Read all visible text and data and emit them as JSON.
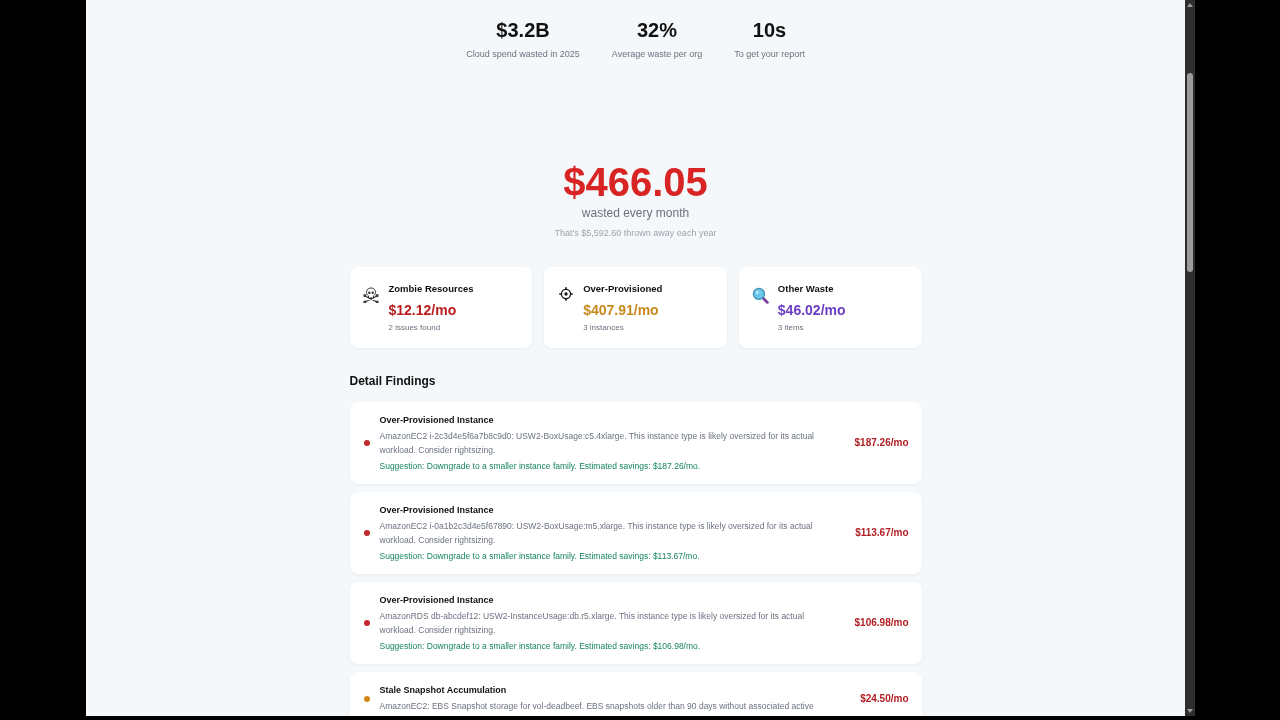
{
  "stats": [
    {
      "value": "$3.2B",
      "label": "Cloud spend wasted in 2025"
    },
    {
      "value": "32%",
      "label": "Average waste per org"
    },
    {
      "value": "10s",
      "label": "To get your report"
    }
  ],
  "total": {
    "amount": "$466.05",
    "caption": "wasted every month",
    "yearly": "That's $5,592.60 thrown away each year"
  },
  "summary_cards": [
    {
      "kind": "zombie",
      "title": "Zombie Resources",
      "amount": "$12.12/mo",
      "detail": "2 issues found",
      "color": "#b91c1c"
    },
    {
      "kind": "overprovisioned",
      "title": "Over-Provisioned",
      "amount": "$407.91/mo",
      "detail": "3 instances",
      "color": "#c98a1d"
    },
    {
      "kind": "other",
      "title": "Other Waste",
      "amount": "$46.02/mo",
      "detail": "3 items",
      "color": "#6b3cc4"
    }
  ],
  "findings": {
    "title": "Detail Findings",
    "items": [
      {
        "title": "Over-Provisioned Instance",
        "description": "AmazonEC2 i-2c3d4e5f6a7b8c9d0: USW2-BoxUsage:c5.4xlarge. This instance type is likely oversized for its actual workload. Consider rightsizing.",
        "suggestion": "Suggestion: Downgrade to a smaller instance family. Estimated savings: $187.26/mo.",
        "amount": "$187.26/mo",
        "color": "#c0282d"
      },
      {
        "title": "Over-Provisioned Instance",
        "description": "AmazonEC2 i-0a1b2c3d4e5f67890: USW2-BoxUsage:m5.xlarge. This instance type is likely oversized for its actual workload. Consider rightsizing.",
        "suggestion": "Suggestion: Downgrade to a smaller instance family. Estimated savings: $113.67/mo.",
        "amount": "$113.67/mo",
        "color": "#c0282d"
      },
      {
        "title": "Over-Provisioned Instance",
        "description": "AmazonRDS db-abcdef12: USW2-InstanceUsage:db.r5.xlarge. This instance type is likely oversized for its actual workload. Consider rightsizing.",
        "suggestion": "Suggestion: Downgrade to a smaller instance family. Estimated savings: $106.98/mo.",
        "amount": "$106.98/mo",
        "color": "#c0282d"
      },
      {
        "title": "Stale Snapshot Accumulation",
        "description": "AmazonEC2: EBS Snapshot storage for vol-deadbeef. EBS snapshots older than 90 days without associated active",
        "amount": "$24.50/mo",
        "color": "#d4871c"
      }
    ]
  }
}
